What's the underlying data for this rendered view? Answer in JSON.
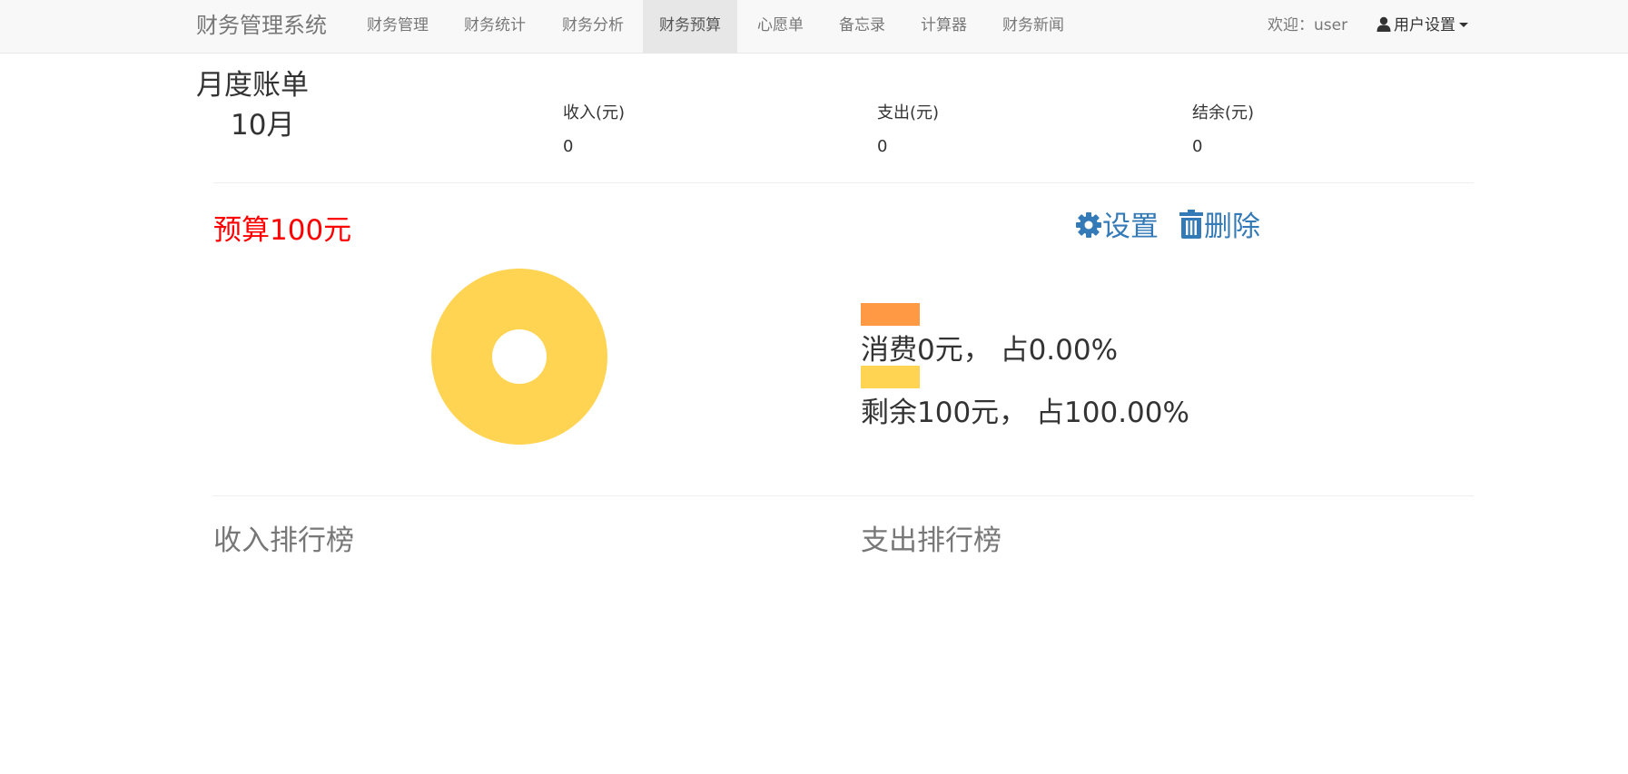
{
  "navbar": {
    "brand": "财务管理系统",
    "items": [
      {
        "label": "财务管理"
      },
      {
        "label": "财务统计"
      },
      {
        "label": "财务分析"
      },
      {
        "label": "财务预算",
        "active": true
      },
      {
        "label": "心愿单"
      },
      {
        "label": "备忘录"
      },
      {
        "label": "计算器"
      },
      {
        "label": "财务新闻"
      }
    ],
    "welcome": "欢迎：user",
    "user_menu": {
      "label": "用户设置",
      "icon": "user-icon"
    }
  },
  "monthly_bill": {
    "title": "月度账单",
    "month": "10月",
    "stats": [
      {
        "label": "收入(元)",
        "value": "0"
      },
      {
        "label": "支出(元)",
        "value": "0"
      },
      {
        "label": "结余(元)",
        "value": "0"
      }
    ]
  },
  "budget": {
    "title": "预算100元",
    "actions": [
      {
        "label": "设置",
        "icon": "gear-icon"
      },
      {
        "label": "删除",
        "icon": "trash-icon"
      }
    ],
    "legend": [
      {
        "text": "消费0元，  占0.00%",
        "color": "#ff9944"
      },
      {
        "text": "剩余100元，  占100.00%",
        "color": "#ffd452"
      }
    ]
  },
  "chart_data": {
    "type": "pie",
    "categories": [
      "消费",
      "剩余"
    ],
    "values": [
      0,
      100
    ],
    "colors": [
      "#ff9944",
      "#ffd452"
    ]
  },
  "rankings": {
    "income_title": "收入排行榜",
    "expense_title": "支出排行榜"
  }
}
